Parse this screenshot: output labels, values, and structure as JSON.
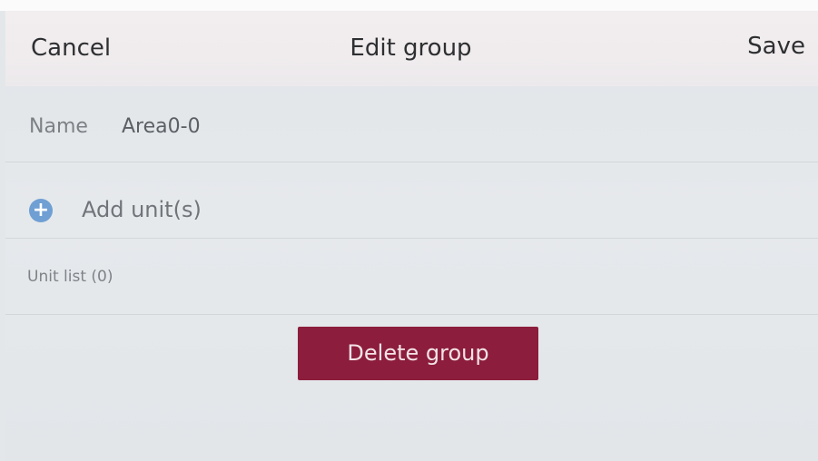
{
  "header": {
    "cancel_label": "Cancel",
    "title": "Edit group",
    "save_label": "Save"
  },
  "name_row": {
    "label": "Name",
    "value": "Area0-0"
  },
  "add_units": {
    "icon": "plus-circle-icon",
    "label": "Add unit(s)"
  },
  "unit_list": {
    "label": "Unit list (0)"
  },
  "delete_button": {
    "label": "Delete group"
  },
  "colors": {
    "header_bg": "#f0ecee",
    "body_bg": "#e3e7ea",
    "add_icon": "#6f9fd3",
    "delete_button": "#8c1d3c"
  }
}
